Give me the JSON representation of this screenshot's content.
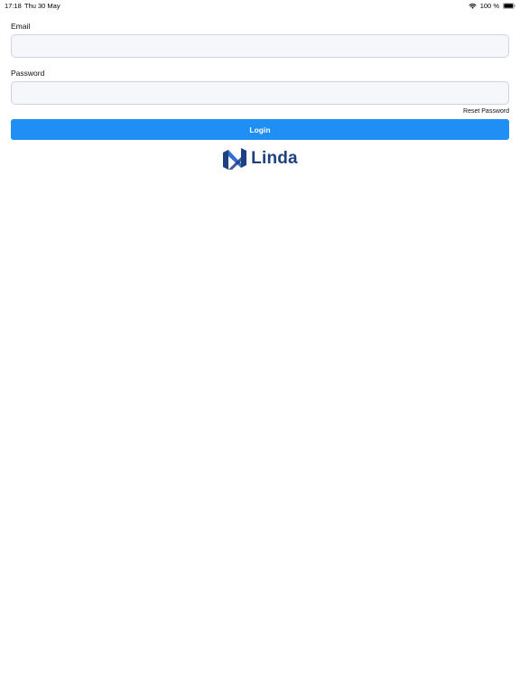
{
  "status_bar": {
    "time": "17:18",
    "date": "Thu 30 May",
    "battery": "100 %",
    "icons": [
      "wifi-icon",
      "battery-icon"
    ]
  },
  "form": {
    "email_label": "Email",
    "email_value": "",
    "password_label": "Password",
    "password_value": "",
    "reset_label": "Reset Password",
    "login_label": "Login"
  },
  "brand": {
    "name": "Linda",
    "icon": "linda-logo-mark-icon"
  },
  "colors": {
    "primary": "#1f8ff5",
    "brand_dark": "#1f3f83",
    "brand_light": "#2f6fd6",
    "input_bg": "#f6f7fb",
    "input_border": "#cfd3dc"
  }
}
